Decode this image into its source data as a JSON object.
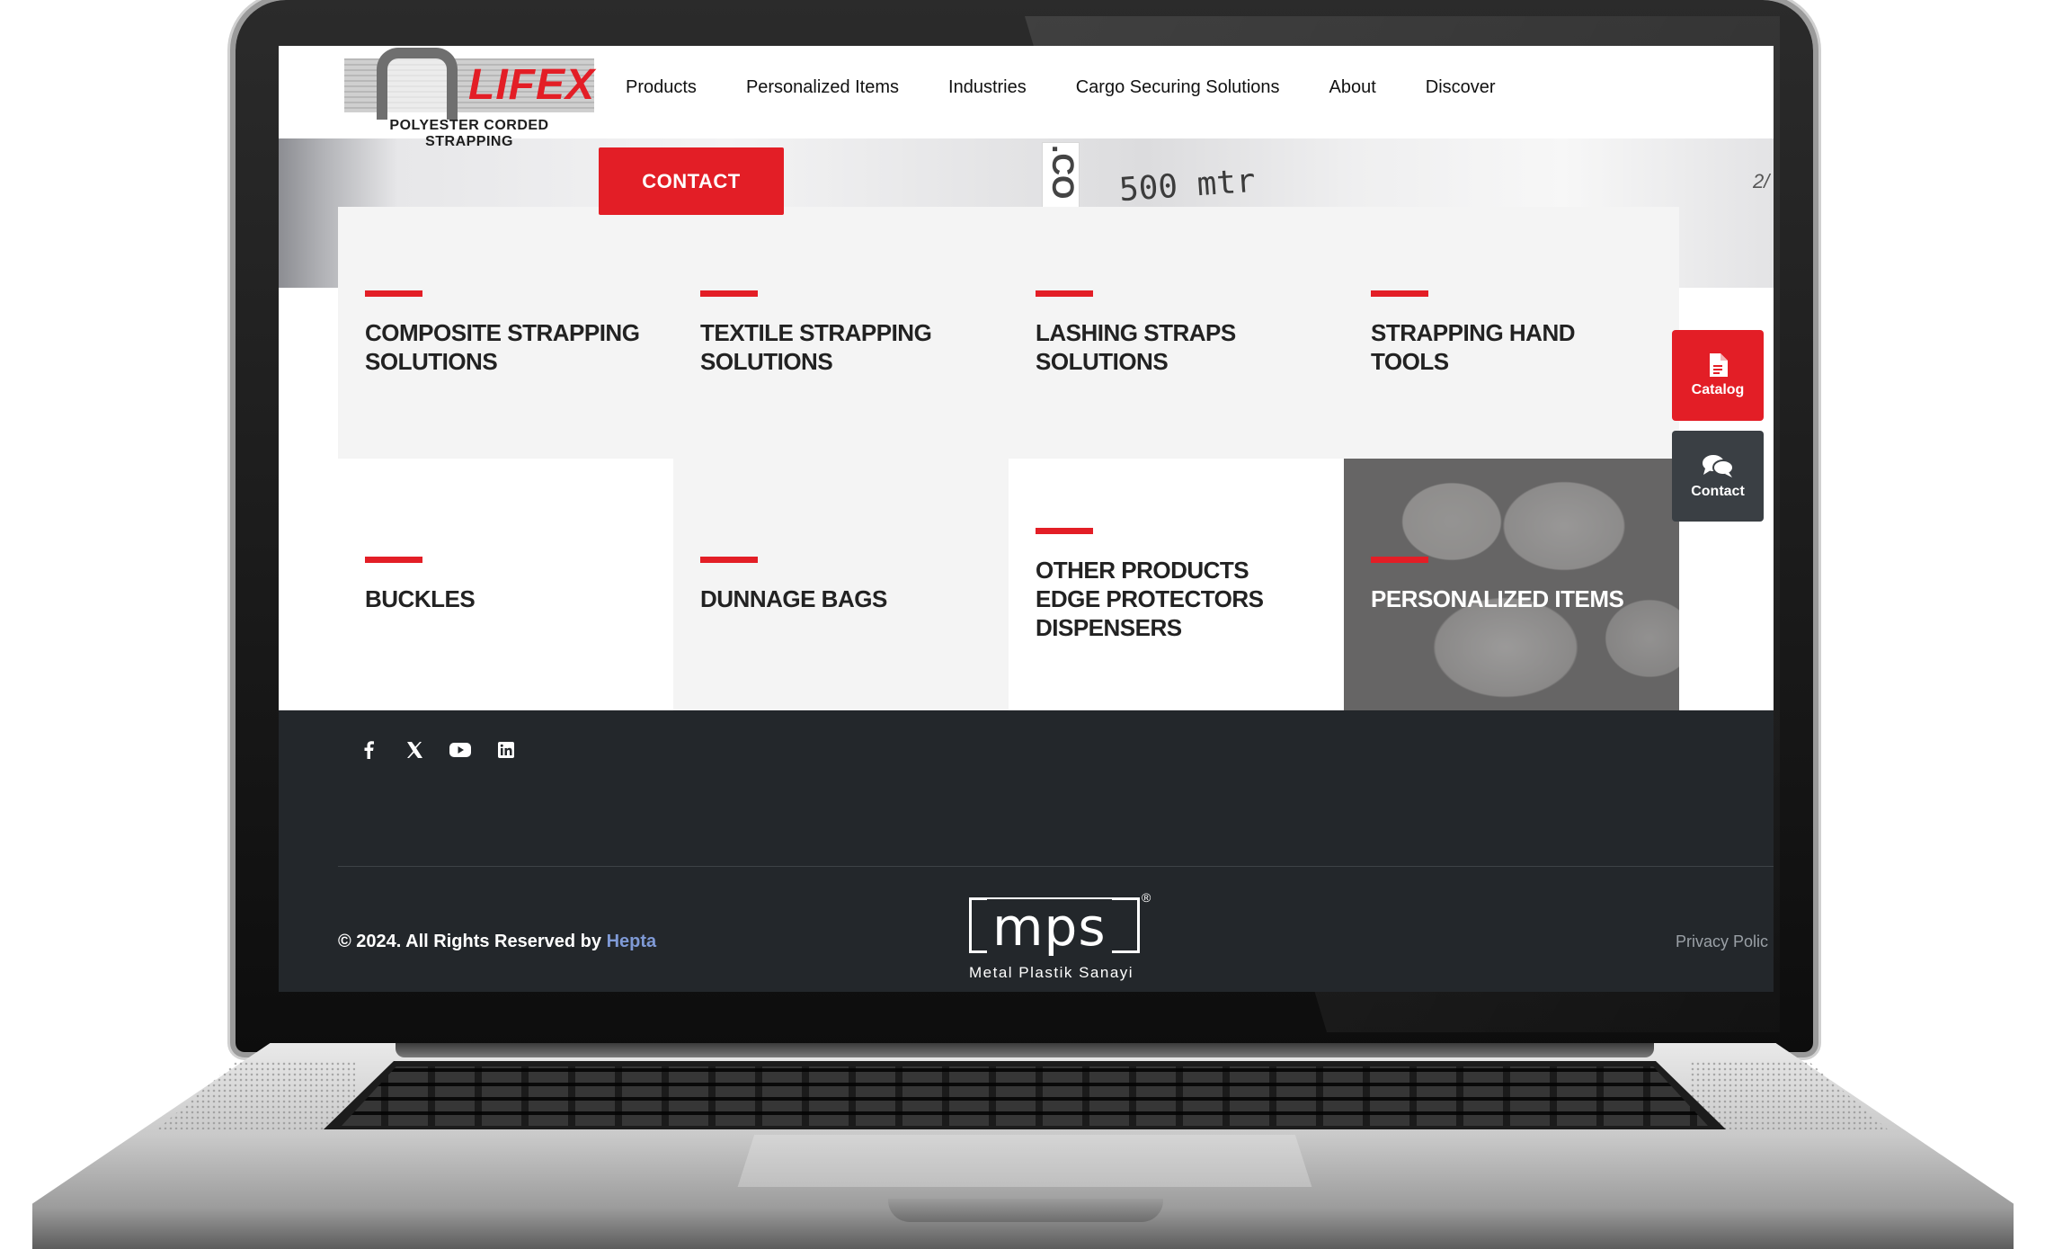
{
  "header": {
    "logo_word": "LIFEX",
    "logo_tagline": "POLYESTER CORDED STRAPPING",
    "nav": [
      "Products",
      "Personalized Items",
      "Industries",
      "Cargo Securing Solutions",
      "About",
      "Discover"
    ],
    "cta": "CONTACT"
  },
  "hero": {
    "roll_text": "500 mtr",
    "label_text": ".CO",
    "small_text": "2/"
  },
  "products": [
    "COMPOSITE STRAPPING\nSOLUTIONS",
    "TEXTILE STRAPPING\nSOLUTIONS",
    "LASHING STRAPS\nSOLUTIONS",
    "STRAPPING HAND\nTOOLS",
    "BUCKLES",
    "DUNNAGE BAGS",
    "OTHER PRODUCTS\nEDGE PROTECTORS\nDISPENSERS",
    "PERSONALIZED ITEMS"
  ],
  "floating": {
    "catalog": "Catalog",
    "contact": "Contact",
    "catalog_icon": "file-icon",
    "contact_icon": "chat-icon"
  },
  "footer": {
    "socials": [
      "facebook-icon",
      "x-icon",
      "youtube-icon",
      "linkedin-icon"
    ],
    "copyright_prefix": "© 2024. All Rights Reserved by",
    "copyright_link": "Hepta",
    "partner_word": "mps",
    "partner_mark": "®",
    "partner_sub": "Metal Plastik Sanayi",
    "privacy": "Privacy Polic"
  },
  "colors": {
    "accent": "#e31e26",
    "footer_bg": "#23272b",
    "link": "#7f9ad6"
  }
}
